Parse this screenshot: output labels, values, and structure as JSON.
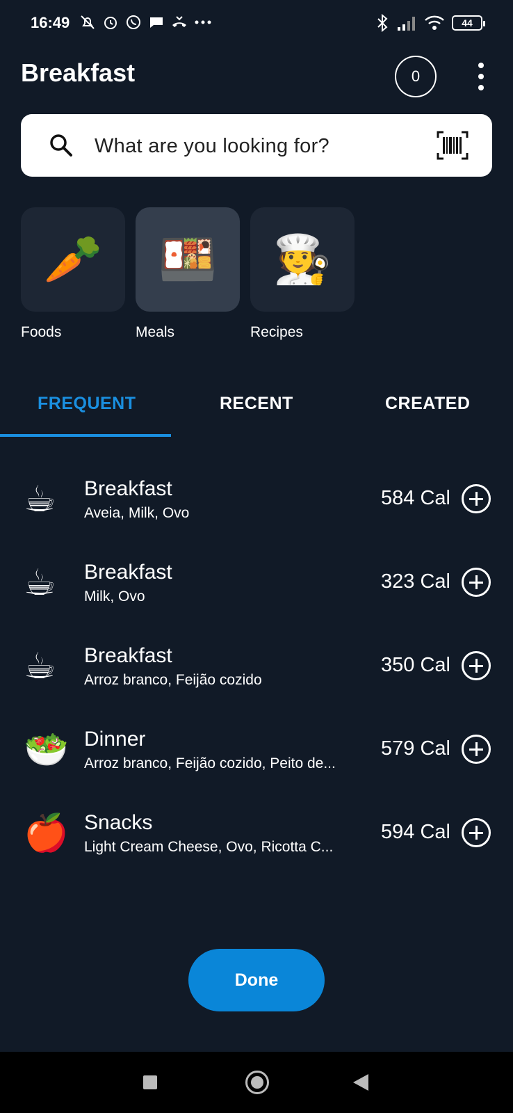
{
  "status_bar": {
    "time": "16:49",
    "battery": "44",
    "icons_left": [
      "mute-bell-icon",
      "alarm-icon",
      "whatsapp-icon",
      "chat-icon",
      "missed-call-icon",
      "more-dots-icon"
    ],
    "icons_right": [
      "bluetooth-icon",
      "signal-icon",
      "wifi-icon",
      "battery-icon"
    ]
  },
  "header": {
    "title": "Breakfast",
    "counter": "0"
  },
  "search": {
    "placeholder": "What are you looking for?"
  },
  "categories": [
    {
      "label": "Foods",
      "emoji": "🥕",
      "active": false
    },
    {
      "label": "Meals",
      "emoji": "🍱",
      "active": true
    },
    {
      "label": "Recipes",
      "emoji": "🧑‍🍳",
      "active": false
    }
  ],
  "tabs": [
    {
      "label": "FREQUENT",
      "active": true
    },
    {
      "label": "RECENT",
      "active": false
    },
    {
      "label": "CREATED",
      "active": false
    }
  ],
  "meals": [
    {
      "emoji": "☕",
      "name": "Breakfast",
      "items": "Aveia, Milk, Ovo",
      "calories": "584 Cal"
    },
    {
      "emoji": "☕",
      "name": "Breakfast",
      "items": "Milk, Ovo",
      "calories": "323 Cal"
    },
    {
      "emoji": "☕",
      "name": "Breakfast",
      "items": "Arroz branco, Feijão cozido",
      "calories": "350 Cal"
    },
    {
      "emoji": "🥗",
      "name": "Dinner",
      "items": "Arroz branco, Feijão cozido, Peito de...",
      "calories": "579 Cal"
    },
    {
      "emoji": "🍎",
      "name": "Snacks",
      "items": "Light Cream Cheese, Ovo, Ricotta C...",
      "calories": "594 Cal"
    }
  ],
  "done_label": "Done",
  "colors": {
    "background": "#111a27",
    "accent": "#1a8fe0",
    "button": "#0a86d8",
    "tile": "#1d2634",
    "tile_active": "#343e4d"
  }
}
